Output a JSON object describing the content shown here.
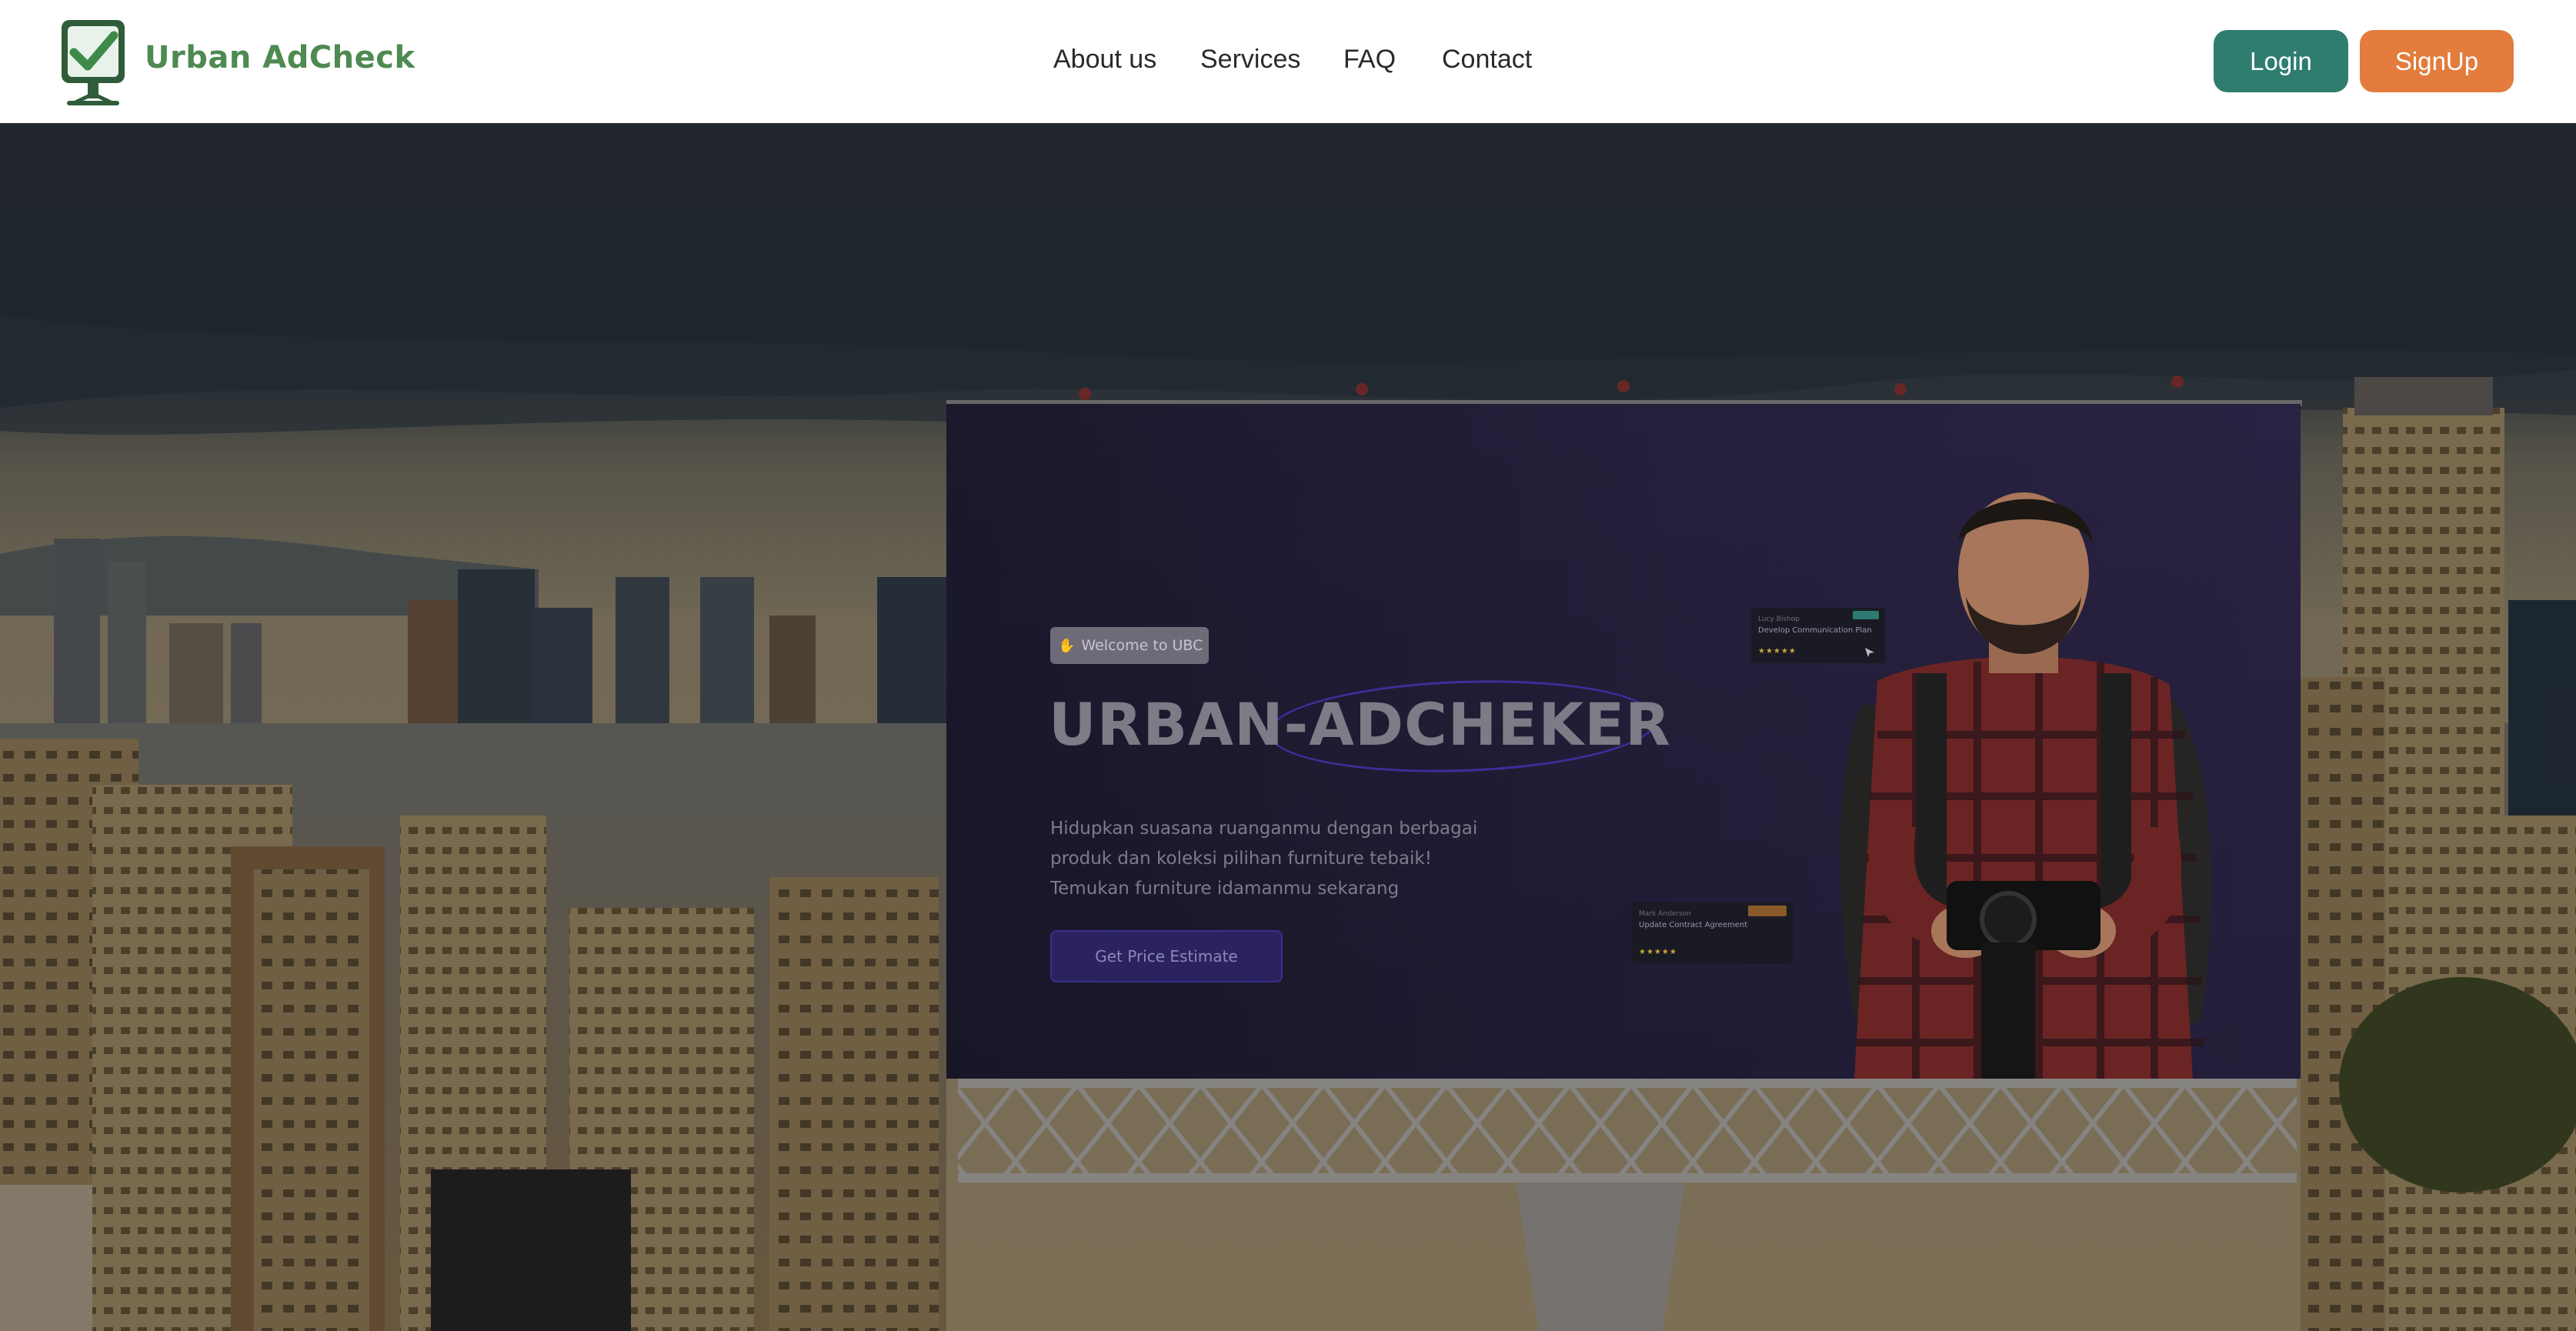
{
  "header": {
    "brand": "Urban AdCheck",
    "nav": [
      "About us",
      "Services",
      "FAQ",
      "Contact"
    ],
    "login": "Login",
    "signup": "SignUp"
  },
  "billboard": {
    "welcome": "Welcome to UBC",
    "title": "URBAN-ADCHEKER",
    "subtitle": [
      "Hidupkan suasana ruanganmu dengan berbagai",
      "produk dan koleksi pilihan furniture tebaik!",
      "Temukan furniture idamanmu sekarang"
    ],
    "cta": "Get Price Estimate",
    "cards": [
      {
        "name": "Lucy Bishop",
        "task": "Develop Communication Plan",
        "stars": "★★★★★"
      },
      {
        "name": "Mark Anderson",
        "task": "Update Contract Agreement",
        "stars": "★★★★★"
      }
    ]
  },
  "icons": [
    "checkmark-monitor-logo-icon",
    "hand-wave-icon",
    "cursor-icon"
  ],
  "colors": {
    "brand_green": "#4e8a52",
    "login_button": "#2f7d6f",
    "signup_button": "#e37c3c"
  }
}
